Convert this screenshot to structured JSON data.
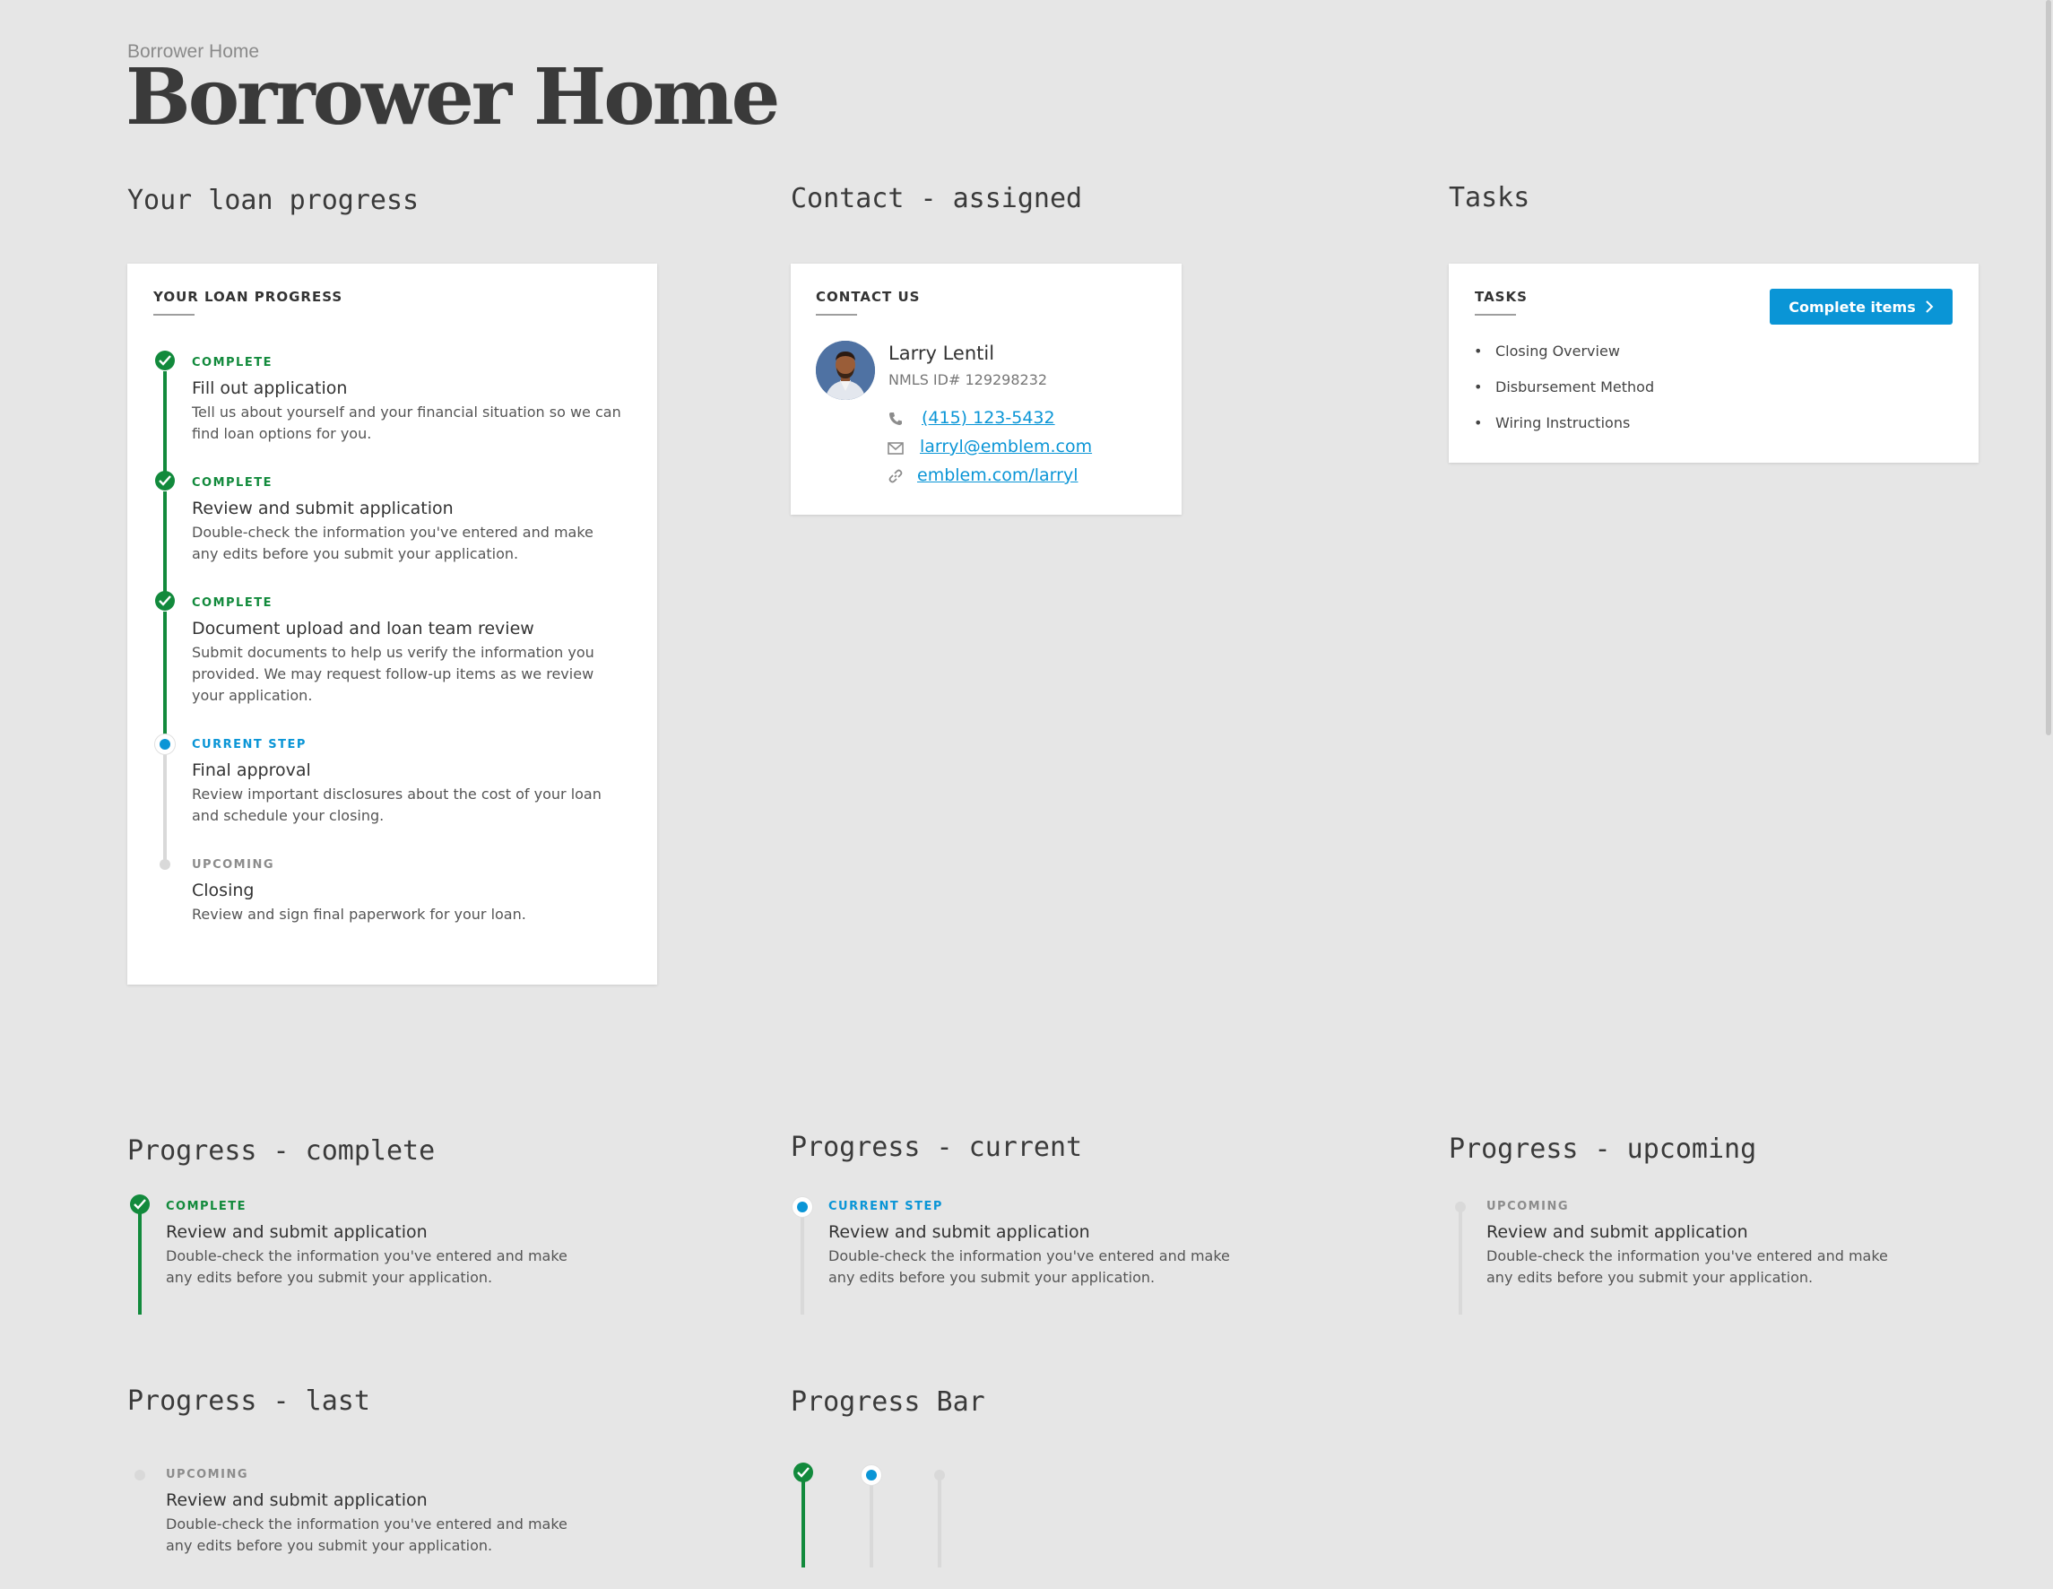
{
  "header": {
    "breadcrumb": "Borrower Home",
    "title": "Borrower Home"
  },
  "sections": {
    "loan_progress": "Your loan progress",
    "contact": "Contact - assigned",
    "tasks": "Tasks",
    "progress_complete": "Progress - complete",
    "progress_current": "Progress - current",
    "progress_upcoming": "Progress - upcoming",
    "progress_last": "Progress - last",
    "progress_bar": "Progress Bar"
  },
  "loan_card": {
    "title": "YOUR LOAN PROGRESS",
    "steps": [
      {
        "status": "COMPLETE",
        "state": "complete",
        "title": "Fill out application",
        "desc": [
          "Tell us about yourself and your financial situation so we can",
          "find loan options for you."
        ]
      },
      {
        "status": "COMPLETE",
        "state": "complete",
        "title": "Review and submit application",
        "desc": [
          "Double-check the information you've entered and make",
          "any edits before you submit your application."
        ]
      },
      {
        "status": "COMPLETE",
        "state": "complete",
        "title": "Document upload and loan team review",
        "desc": [
          "Submit documents to help us verify the information you",
          "provided. We may request follow-up items as we review",
          "your application."
        ]
      },
      {
        "status": "CURRENT STEP",
        "state": "current",
        "title": "Final approval",
        "desc": [
          "Review important disclosures about the cost of your loan",
          "and schedule your closing."
        ]
      },
      {
        "status": "UPCOMING",
        "state": "upcoming",
        "title": "Closing",
        "desc": [
          "Review and sign final paperwork for your loan."
        ]
      }
    ]
  },
  "contact_card": {
    "title": "CONTACT US",
    "name": "Larry Lentil",
    "nmls": "NMLS ID# 129298232",
    "phone": "(415) 123-5432",
    "email": "larryl@emblem.com",
    "website": "emblem.com/larryl"
  },
  "tasks_card": {
    "title": "TASKS",
    "button_label": "Complete items",
    "items": [
      "Closing Overview",
      "Disbursement Method",
      "Wiring Instructions"
    ]
  },
  "examples": {
    "complete": {
      "status": "COMPLETE",
      "title": "Review and submit application",
      "desc": [
        "Double-check the information you've entered and make",
        "any edits before you submit your application."
      ]
    },
    "current": {
      "status": "CURRENT STEP",
      "title": "Review and submit application",
      "desc": [
        "Double-check the information you've entered and make",
        "any edits before you submit your application."
      ]
    },
    "upcoming": {
      "status": "UPCOMING",
      "title": "Review and submit application",
      "desc": [
        "Double-check the information you've entered and make",
        "any edits before you submit your application."
      ]
    },
    "last": {
      "status": "UPCOMING",
      "title": "Review and submit application",
      "desc": [
        "Double-check the information you've entered and make",
        "any edits before you submit your application."
      ]
    }
  },
  "colors": {
    "complete": "#128a3c",
    "current": "#0a95d6",
    "upcoming": "#d9d9d9",
    "background": "#e6e6e6"
  }
}
